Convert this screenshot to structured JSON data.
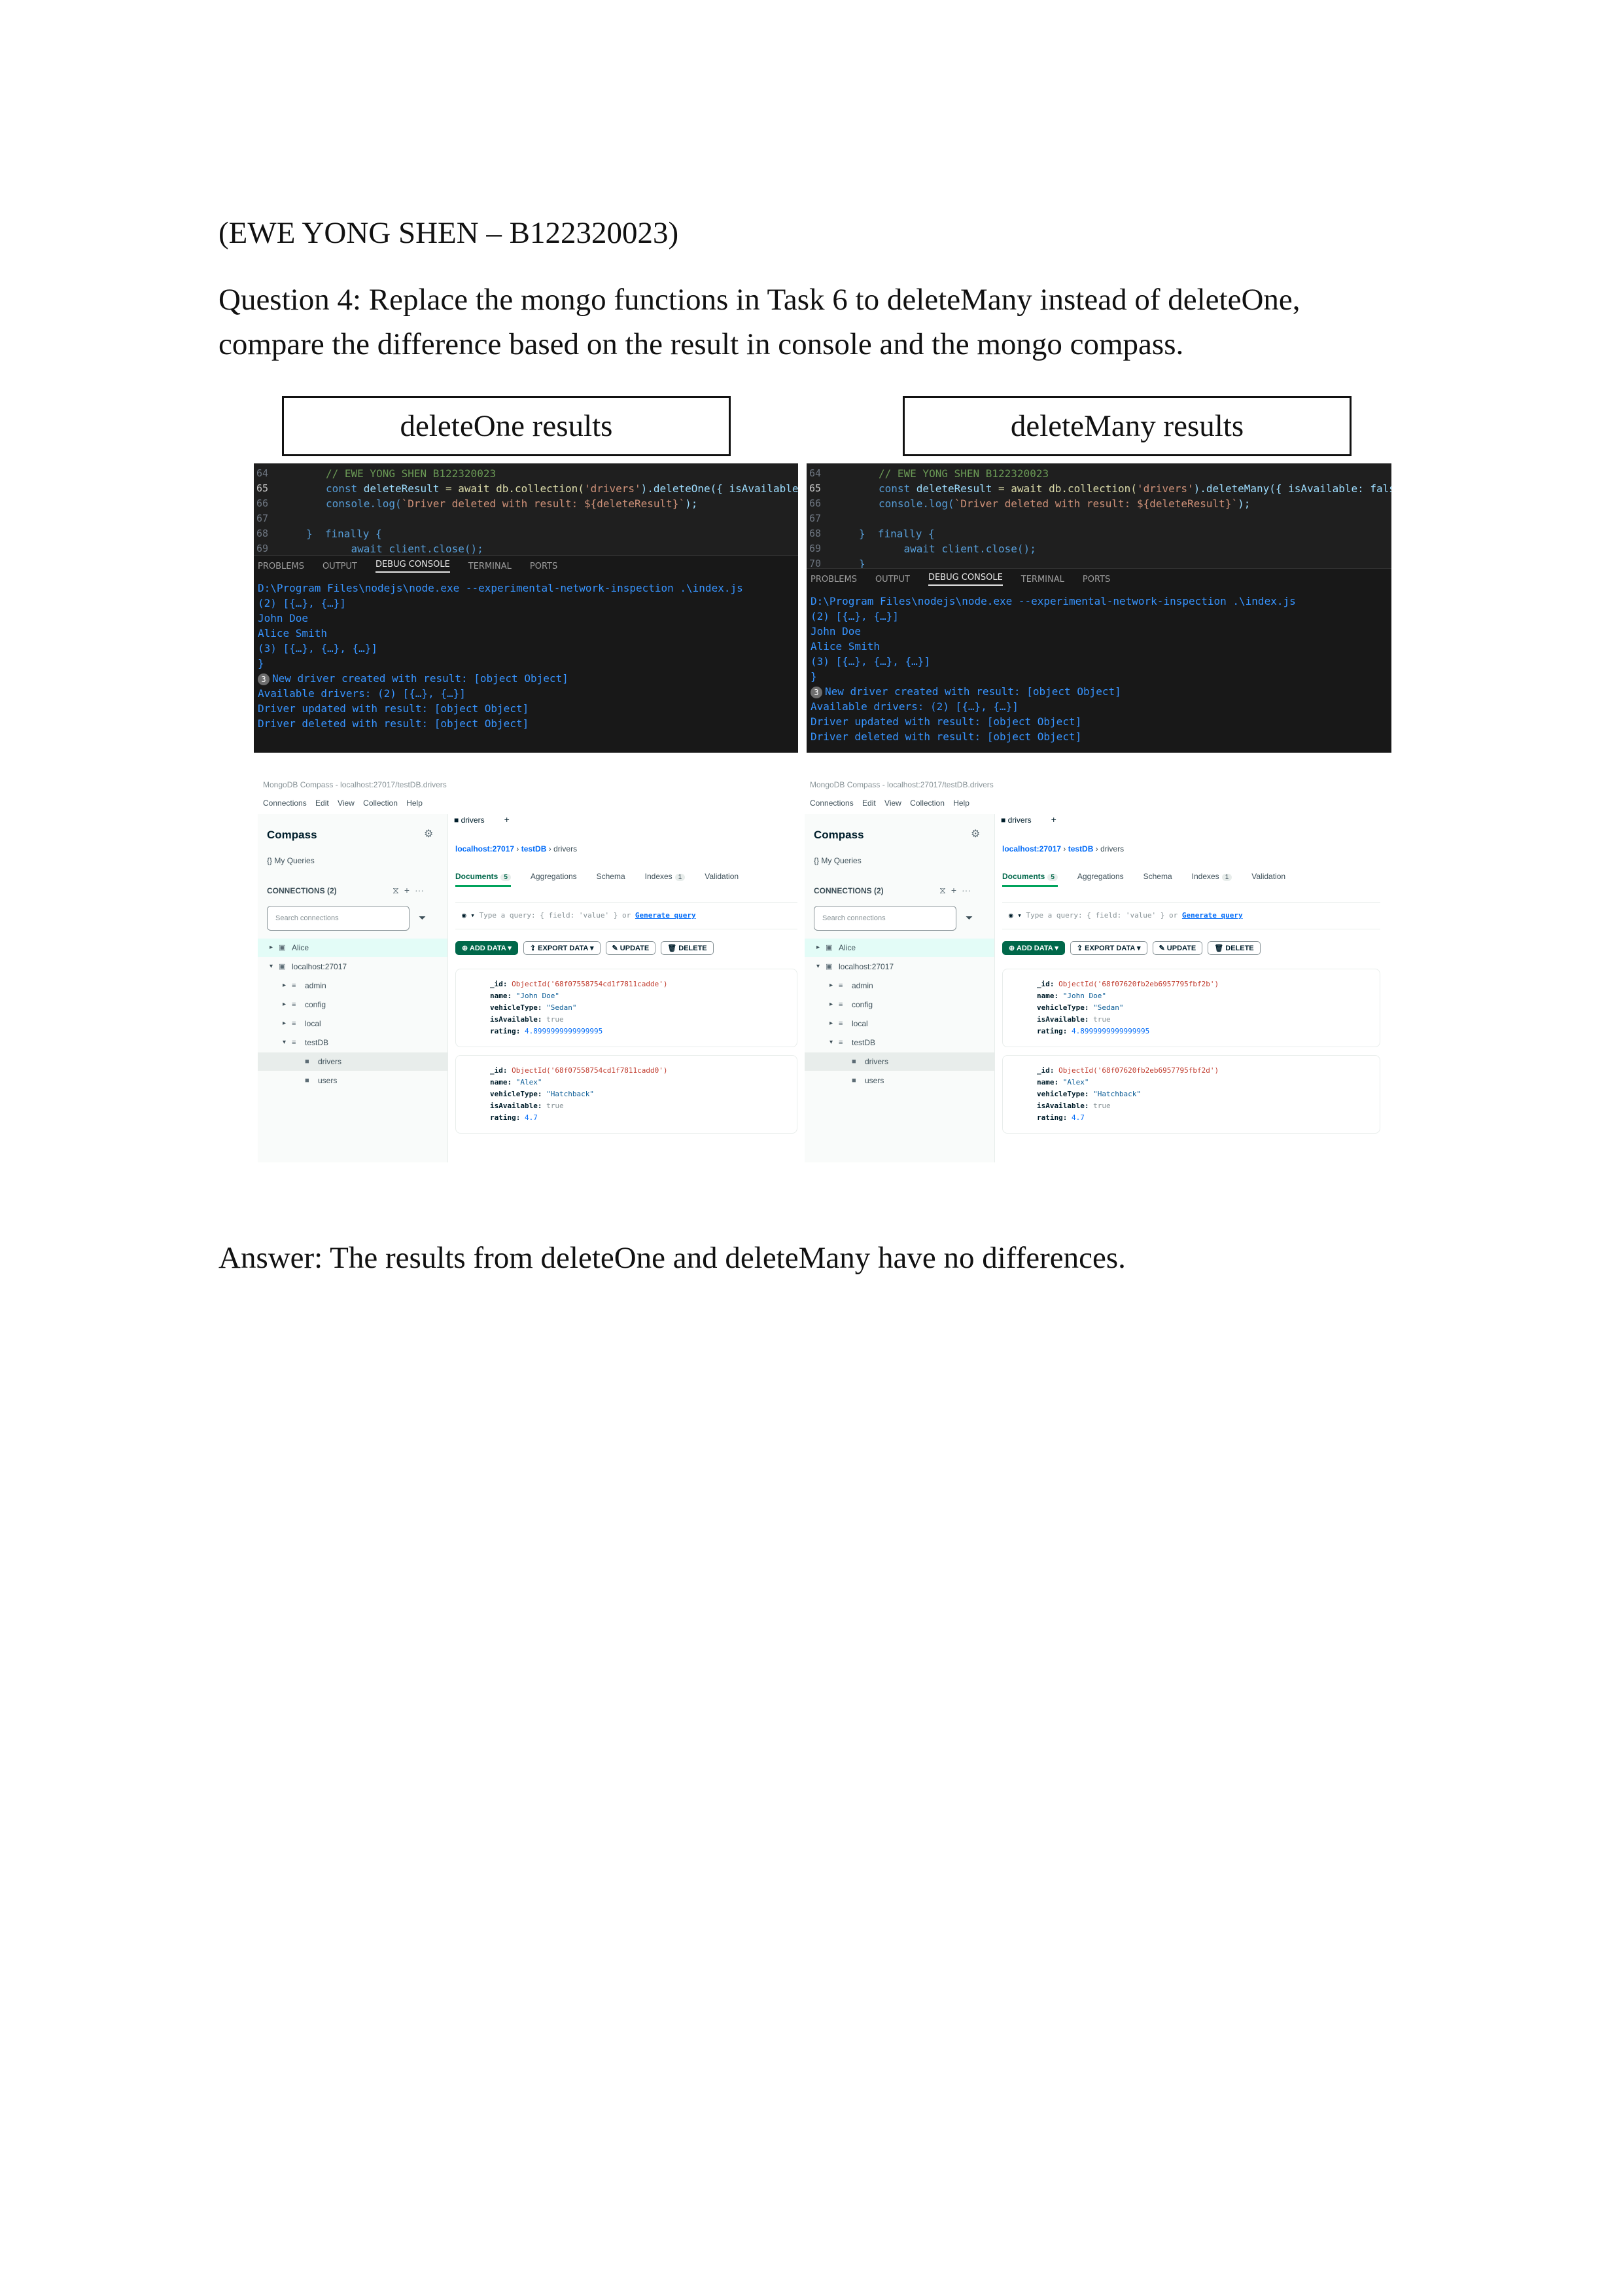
{
  "header": {
    "author_line": "(EWE YONG SHEN – B122320023)",
    "question": "Question 4: Replace the mongo functions in Task 6 to deleteMany instead of deleteOne, compare the difference based on the result in console and the mongo compass."
  },
  "labels": {
    "left": "deleteOne results",
    "right": "deleteMany results"
  },
  "code_left": {
    "lines": [
      {
        "num": "64",
        "comment": "// EWE YONG SHEN B122320023"
      },
      {
        "num": "65",
        "pre": "const ",
        "var": "deleteResult",
        "mid": " = await db.collection(",
        "str": "'drivers'",
        "post": ").deleteOne({ isAvailable: false });"
      },
      {
        "num": "66",
        "pre": "console.log(",
        "str": "`Driver deleted with result: ${deleteResult}`",
        "post": ");"
      },
      {
        "num": "67",
        "pre": ""
      },
      {
        "num": "68",
        "pre": "}  finally {"
      },
      {
        "num": "69",
        "pre": "    await client.close();"
      }
    ]
  },
  "code_right": {
    "lines": [
      {
        "num": "64",
        "comment": "// EWE YONG SHEN B122320023"
      },
      {
        "num": "65",
        "pre": "const ",
        "var": "deleteResult",
        "mid": " = await db.collection(",
        "str": "'drivers'",
        "post": ").deleteMany({ isAvailable: false });"
      },
      {
        "num": "66",
        "pre": "console.log(",
        "str": "`Driver deleted with result: ${deleteResult}`",
        "post": ");"
      },
      {
        "num": "67",
        "pre": ""
      },
      {
        "num": "68",
        "pre": "}  finally {"
      },
      {
        "num": "69",
        "pre": "    await client.close();"
      },
      {
        "num": "70",
        "pre": "}"
      }
    ]
  },
  "panel_tabs": [
    "PROBLEMS",
    "OUTPUT",
    "DEBUG CONSOLE",
    "TERMINAL",
    "PORTS"
  ],
  "console": {
    "lines": [
      "D:\\Program Files\\nodejs\\node.exe --experimental-network-inspection .\\index.js",
      "(2) [{…}, {…}]",
      "John Doe",
      "Alice Smith",
      "(3) [{…}, {…}, {…}]",
      "}",
      "New driver created with result: [object Object]",
      "Available drivers: (2) [{…}, {…}]",
      "Driver updated with result: [object Object]",
      "Driver deleted with result: [object Object]"
    ],
    "badge": "3"
  },
  "compass": {
    "window_title": "MongoDB Compass - localhost:27017/testDB.drivers",
    "menu": "Connections Edit View Collection Help",
    "sidebar_title": "Compass",
    "my_queries": "My Queries",
    "connections_label": "CONNECTIONS (2)",
    "search_placeholder": "Search connections",
    "tree": [
      {
        "label": "Alice",
        "depth": 0,
        "caret": "▸",
        "icon": "▣"
      },
      {
        "label": "localhost:27017",
        "depth": 0,
        "caret": "▾",
        "icon": "▣"
      },
      {
        "label": "admin",
        "depth": 1,
        "caret": "▸",
        "icon": "≡"
      },
      {
        "label": "config",
        "depth": 1,
        "caret": "▸",
        "icon": "≡"
      },
      {
        "label": "local",
        "depth": 1,
        "caret": "▸",
        "icon": "≡"
      },
      {
        "label": "testDB",
        "depth": 1,
        "caret": "▾",
        "icon": "≡"
      },
      {
        "label": "drivers",
        "depth": 2,
        "caret": "",
        "icon": "■"
      },
      {
        "label": "users",
        "depth": 2,
        "caret": "",
        "icon": "■"
      }
    ],
    "collection_tab": "drivers",
    "breadcrumb": {
      "host": "localhost:27017",
      "db": "testDB",
      "coll": "drivers"
    },
    "subtabs": [
      "Documents",
      "Aggregations",
      "Schema",
      "Indexes",
      "Validation"
    ],
    "documents_count": "5",
    "indexes_count": "1",
    "query_placeholder": "Type a query: { field: 'value' } or",
    "generate_query": "Generate query",
    "buttons": {
      "add": "ADD DATA",
      "export": "EXPORT DATA",
      "update": "UPDATE",
      "delete": "DELETE"
    }
  },
  "docs_left": [
    {
      "id": "ObjectId('68f07558754cd1f7811cadde')",
      "name": "\"John Doe\"",
      "vehicleType": "\"Sedan\"",
      "isAvailable": "true",
      "rating": "4.8999999999999995"
    },
    {
      "id": "ObjectId('68f07558754cd1f7811cadd0')",
      "name": "\"Alex\"",
      "vehicleType": "\"Hatchback\"",
      "isAvailable": "true",
      "rating": "4.7"
    }
  ],
  "docs_right": [
    {
      "id": "ObjectId('68f07620fb2eb6957795fbf2b')",
      "name": "\"John Doe\"",
      "vehicleType": "\"Sedan\"",
      "isAvailable": "true",
      "rating": "4.8999999999999995"
    },
    {
      "id": "ObjectId('68f07620fb2eb6957795fbf2d')",
      "name": "\"Alex\"",
      "vehicleType": "\"Hatchback\"",
      "isAvailable": "true",
      "rating": "4.7"
    }
  ],
  "answer": "Answer: The results from deleteOne and deleteMany have no differences."
}
